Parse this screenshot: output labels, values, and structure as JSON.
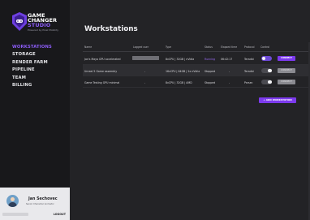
{
  "brand": {
    "line1": "GAME",
    "line2": "CHANGER",
    "line3": "STUDIO",
    "sub": "Powered by Pixel Mobility",
    "accent": "#8c5cf6"
  },
  "nav": {
    "items": [
      "WORKSTATIONS",
      "STORAGE",
      "RENDER FARM",
      "PIPELINE",
      "TEAM",
      "BILLING"
    ]
  },
  "user": {
    "name": "Jan Sechovec",
    "role": "Senior Character Animator",
    "logout": "LOGOUT"
  },
  "page": {
    "title": "Workstations",
    "add_button": "+ ADD WORKSTATION"
  },
  "table": {
    "headers": [
      "Name",
      "Logged user",
      "Type",
      "Status",
      "Elapsed time",
      "Protocol",
      "Control"
    ],
    "rows": [
      {
        "name": "Jan's Maya GPU accelerated",
        "logged_user": "",
        "type": "8vCPU | 32GB | nVidia",
        "status": "Running",
        "elapsed": "06:42:17",
        "protocol": "Teradici",
        "control": "on",
        "action": "CONNECT"
      },
      {
        "name": "Unreal 5 Game assembly",
        "logged_user": "-",
        "type": "16vCPU | 64GB | 2x nVidia",
        "status": "Stopped",
        "elapsed": "-",
        "protocol": "Teradici",
        "control": "off",
        "action": "CONNECT"
      },
      {
        "name": "Game Testing GPU minimal",
        "logged_user": "-",
        "type": "8vCPU | 32GB | AMD",
        "status": "Stopped",
        "elapsed": "-",
        "protocol": "Parsec",
        "control": "off",
        "action": "CONNECT"
      }
    ]
  },
  "icons": {
    "logo": "controller-badge-icon",
    "avatar": "user-avatar"
  }
}
